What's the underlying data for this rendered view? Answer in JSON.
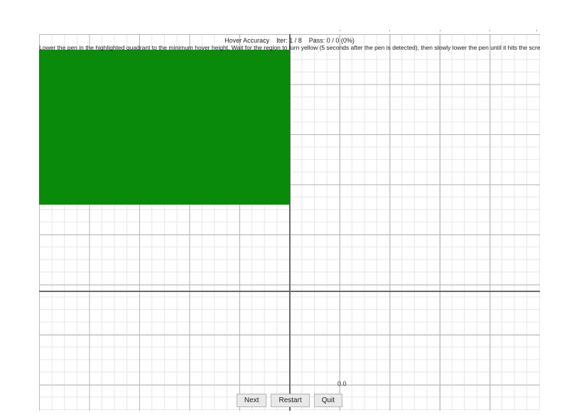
{
  "header": {
    "title_prefix": "Hover Accuracy",
    "iter_label": "Iter:",
    "iter_current": 1,
    "iter_total": 8,
    "pass_label": "Pass:",
    "pass_count": 0,
    "pass_total": 0,
    "pass_percent": "0%"
  },
  "instructions": "Lower the pen in the highlighted quadrant to the minimum hover height. Wait for the region to turn yellow (5 seconds after the pen is detected), then slowly lower the pen until it hits the screen. When the region turns green again, lift the pen.",
  "readout": {
    "value": "0.0"
  },
  "buttons": {
    "next": "Next",
    "restart": "Restart",
    "quit": "Quit"
  },
  "quadrant": {
    "highlighted": "top-left",
    "color": "#0a8a0a"
  },
  "chart_data": {
    "type": "scatter",
    "title": "Hover Accuracy",
    "series": [],
    "x": [],
    "y": [],
    "xlim": [
      -5,
      5
    ],
    "ylim": [
      -5,
      5
    ],
    "xlabel": "",
    "ylabel": "",
    "grid": true,
    "origin": [
      0,
      0
    ]
  }
}
